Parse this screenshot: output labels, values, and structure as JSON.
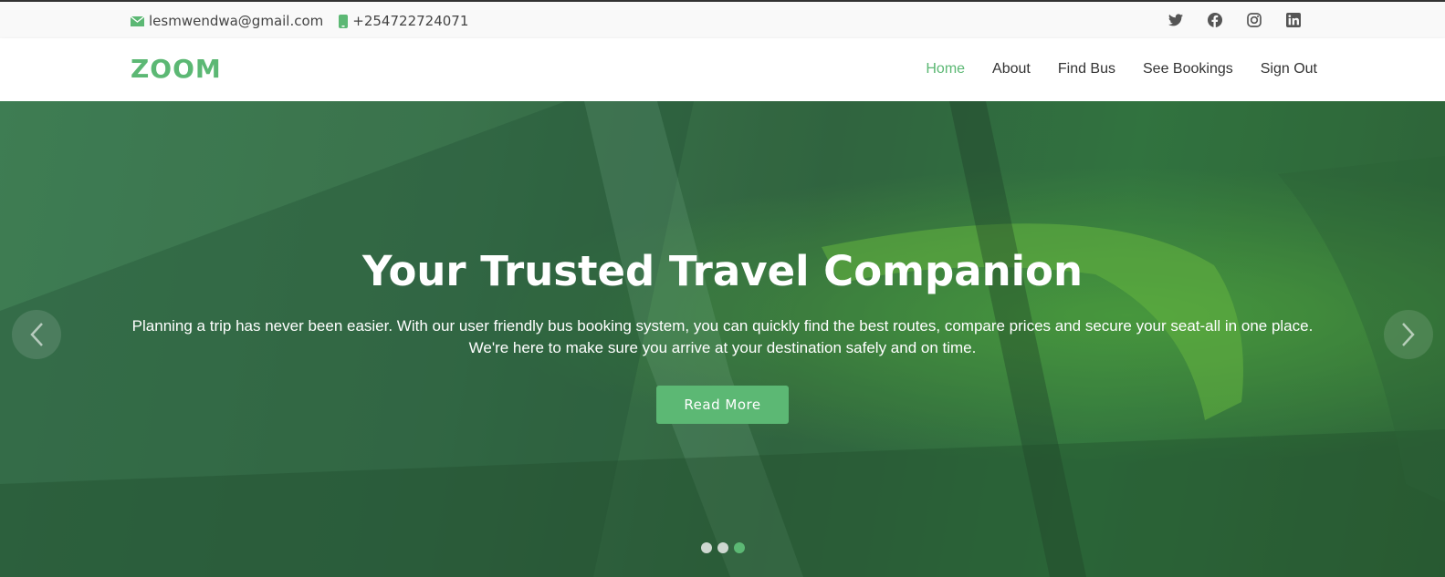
{
  "topbar": {
    "email": "lesmwendwa@gmail.com",
    "phone": "+254722724071",
    "email_icon": "envelope-icon",
    "phone_icon": "mobile-phone-icon",
    "socials": [
      "twitter-icon",
      "facebook-icon",
      "instagram-icon",
      "linkedin-icon"
    ]
  },
  "navbar": {
    "logo": "ZOOM",
    "menu": [
      {
        "label": "Home",
        "active": true
      },
      {
        "label": "About",
        "active": false
      },
      {
        "label": "Find Bus",
        "active": false
      },
      {
        "label": "See Bookings",
        "active": false
      },
      {
        "label": "Sign Out",
        "active": false
      }
    ]
  },
  "hero": {
    "title": "Your Trusted Travel Companion",
    "text_line1": "Planning a trip has never been easier. With our user friendly bus booking system, you can quickly find the best routes, compare prices and secure your seat-all in one place.",
    "text_line2": "We're here to make sure you arrive at your destination safely and on time.",
    "button": "Read More",
    "slides_total": 3,
    "active_slide": 3
  },
  "colors": {
    "accent": "#5cb874",
    "text": "#444444",
    "topbar_bg": "#f9f9f9"
  }
}
